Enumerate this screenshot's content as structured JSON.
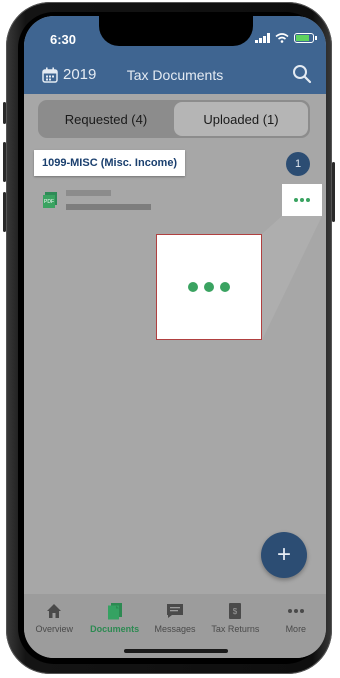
{
  "status": {
    "time": "6:30"
  },
  "header": {
    "year": "2019",
    "title": "Tax Documents",
    "icons": [
      "calendar-icon",
      "search-icon"
    ]
  },
  "segments": {
    "requested": "Requested (4)",
    "uploaded": "Uploaded (1)",
    "selected": "uploaded"
  },
  "document": {
    "category": "1099-MISC (Misc. Income)",
    "count": "1",
    "file_icon": "pdf-icon",
    "file_icon_text": "PDF"
  },
  "fab": {
    "label": "+"
  },
  "tabs": [
    {
      "label": "Overview",
      "icon": "home-icon"
    },
    {
      "label": "Documents",
      "icon": "documents-icon",
      "active": true
    },
    {
      "label": "Messages",
      "icon": "messages-icon"
    },
    {
      "label": "Tax Returns",
      "icon": "tax-returns-icon"
    },
    {
      "label": "More",
      "icon": "more-icon"
    }
  ],
  "colors": {
    "header": "#3f6591",
    "accent_green": "#3aa361",
    "badge": "#2c4d73"
  }
}
